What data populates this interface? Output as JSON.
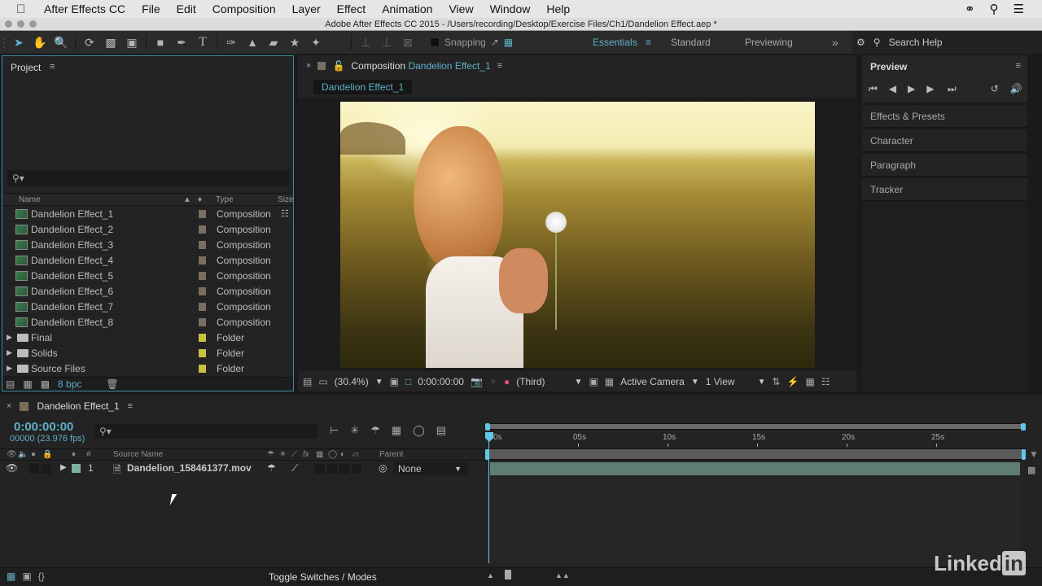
{
  "menubar": {
    "app_name": "After Effects CC",
    "items": [
      "File",
      "Edit",
      "Composition",
      "Layer",
      "Effect",
      "Animation",
      "View",
      "Window",
      "Help"
    ]
  },
  "titlebar": {
    "title": "Adobe After Effects CC 2015 - /Users/recording/Desktop/Exercise Files/Ch1/Dandelion Effect.aep *"
  },
  "toolbar": {
    "tools": [
      "selection-tool",
      "hand-tool",
      "zoom-tool",
      "rotation-tool",
      "camera-tool",
      "pan-behind-tool",
      "rectangle-tool",
      "pen-tool",
      "type-tool",
      "brush-tool",
      "clone-stamp-tool",
      "eraser-tool",
      "roto-brush-tool",
      "puppet-pin-tool"
    ],
    "snapping_label": "Snapping",
    "workspaces": [
      "Essentials",
      "Standard",
      "Previewing"
    ],
    "active_workspace": "Essentials",
    "more": "»",
    "search_help": "Search Help"
  },
  "project": {
    "title": "Project",
    "search_placeholder": "",
    "columns": {
      "name": "Name",
      "type": "Type",
      "size": "Size"
    },
    "items": [
      {
        "name": "Dandelion Effect_1",
        "type": "Composition",
        "kind": "comp",
        "label_color": "#7a6e60"
      },
      {
        "name": "Dandelion Effect_2",
        "type": "Composition",
        "kind": "comp",
        "label_color": "#7a6e60"
      },
      {
        "name": "Dandelion Effect_3",
        "type": "Composition",
        "kind": "comp",
        "label_color": "#7a6e60"
      },
      {
        "name": "Dandelion Effect_4",
        "type": "Composition",
        "kind": "comp",
        "label_color": "#7a6e60"
      },
      {
        "name": "Dandelion Effect_5",
        "type": "Composition",
        "kind": "comp",
        "label_color": "#7a6e60"
      },
      {
        "name": "Dandelion Effect_6",
        "type": "Composition",
        "kind": "comp",
        "label_color": "#7a6e60"
      },
      {
        "name": "Dandelion Effect_7",
        "type": "Composition",
        "kind": "comp",
        "label_color": "#7a6e60"
      },
      {
        "name": "Dandelion Effect_8",
        "type": "Composition",
        "kind": "comp",
        "label_color": "#7a6e60"
      },
      {
        "name": "Final",
        "type": "Folder",
        "kind": "folder",
        "label_color": "#c8c040"
      },
      {
        "name": "Solids",
        "type": "Folder",
        "kind": "folder",
        "label_color": "#c8c040"
      },
      {
        "name": "Source Files",
        "type": "Folder",
        "kind": "folder",
        "label_color": "#c8c040"
      }
    ],
    "bpc": "8 bpc"
  },
  "composition": {
    "header_prefix": "Composition",
    "header_name": "Dandelion Effect_1",
    "tab": "Dandelion Effect_1",
    "magnification": "(30.4%)",
    "timecode": "0:00:00:00",
    "resolution": "(Third)",
    "camera": "Active Camera",
    "views": "1 View"
  },
  "preview": {
    "title": "Preview",
    "controls": [
      "first-frame",
      "previous-frame",
      "play",
      "next-frame",
      "last-frame"
    ]
  },
  "right_panels": [
    "Effects & Presets",
    "Character",
    "Paragraph",
    "Tracker"
  ],
  "timeline": {
    "tab": "Dandelion Effect_1",
    "timecode": "0:00:00:00",
    "frames_fps": "00000 (23.976 fps)",
    "columns": {
      "num": "#",
      "source_name": "Source Name",
      "parent": "Parent"
    },
    "layers": [
      {
        "index": "1",
        "name": "Dandelion_158461377.mov",
        "parent": "None",
        "label_color": "#7fb0a0"
      }
    ],
    "ruler": {
      "labels": [
        "0s",
        "05s",
        "10s",
        "15s",
        "20s",
        "25s"
      ],
      "duration_seconds": 30,
      "current_time_seconds": 0
    },
    "toggle_label": "Toggle Switches / Modes"
  },
  "watermark": {
    "text": "Linked",
    "in": "in"
  },
  "colors": {
    "accent": "#5fb0c8",
    "panel": "#232323",
    "layer_bar": "#5f7d74"
  }
}
